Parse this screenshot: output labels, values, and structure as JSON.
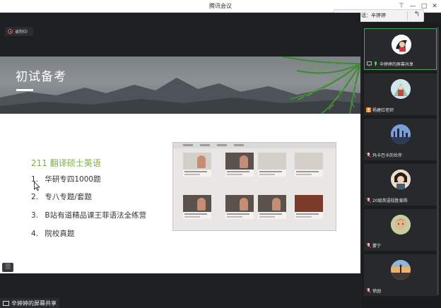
{
  "window": {
    "title": "腾讯会议"
  },
  "speaker_bar": {
    "prefix": "正在讲话：",
    "name": "辛婷婷"
  },
  "recording": {
    "label": "录制中"
  },
  "slide": {
    "title": "初试备考",
    "section_title": "211 翻译硕士英语",
    "items": [
      {
        "num": "1.",
        "text": "华研专四1000题"
      },
      {
        "num": "2.",
        "text": "专八专题/套题"
      },
      {
        "num": "3.",
        "text": "B站有道精品课王菲语法全练营"
      },
      {
        "num": "4.",
        "text": "院校真题"
      }
    ]
  },
  "share_label": {
    "text": "辛婷婷的屏幕共享"
  },
  "participants": [
    {
      "name": "辛婷婷的屏幕共享",
      "icon": "screen-share-icon",
      "active": true
    },
    {
      "name": "杨建红老师",
      "icon": "host-icon",
      "active": false
    },
    {
      "name": "玛卡巴卡的伙伴",
      "icon": "mic-muted-icon",
      "active": false
    },
    {
      "name": "20级英语段胜菊杨",
      "icon": "mic-muted-icon",
      "active": false
    },
    {
      "name": "蒙宁",
      "icon": "mic-muted-icon",
      "active": false
    },
    {
      "name": "徐园",
      "icon": "mic-muted-icon",
      "active": false
    }
  ],
  "colors": {
    "accent_green": "#7bb141",
    "active_border": "#4aa35c",
    "host_orange": "#e98a2c"
  }
}
